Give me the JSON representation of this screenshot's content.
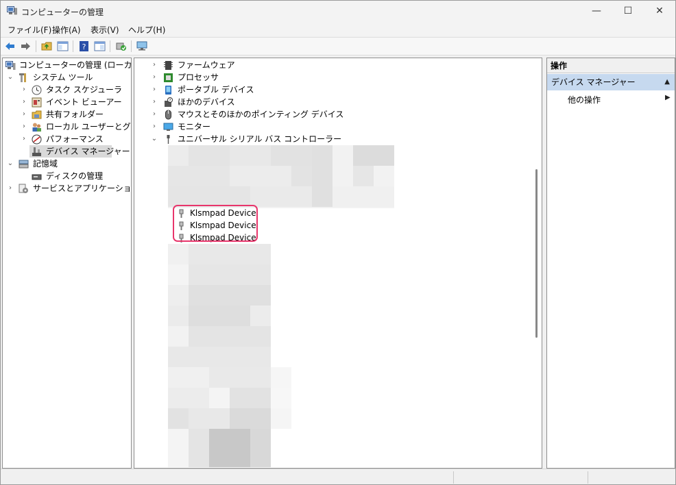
{
  "window": {
    "title": "コンピューターの管理",
    "controls": {
      "minimize": "—",
      "maximize": "☐",
      "close": "✕"
    }
  },
  "menu": [
    "ファイル(F)",
    "操作(A)",
    "表示(V)",
    "ヘルプ(H)"
  ],
  "toolbar": [
    "back-icon",
    "forward-icon",
    "up-folder-icon",
    "show-hide-tree-icon",
    "help-icon",
    "properties-icon",
    "update-driver-icon",
    "scan-hardware-icon"
  ],
  "tree": {
    "root": "コンピューターの管理 (ローカル)",
    "system_tools": "システム ツール",
    "task_scheduler": "タスク スケジューラ",
    "event_viewer": "イベント ビューアー",
    "shared_folders": "共有フォルダー",
    "local_users": "ローカル ユーザーとグループ",
    "performance": "パフォーマンス",
    "device_manager": "デバイス マネージャー",
    "storage": "記憶域",
    "disk_management": "ディスクの管理",
    "services_apps": "サービスとアプリケーション"
  },
  "devices": {
    "firmware": "ファームウェア",
    "processor": "プロセッサ",
    "portable": "ポータブル デバイス",
    "other": "ほかのデバイス",
    "mouse": "マウスとそのほかのポインティング デバイス",
    "monitor": "モニター",
    "usb": "ユニバーサル シリアル バス コントローラー",
    "usb_children": [
      "Klsmpad Device",
      "Klsmpad Device",
      "Klsmpad Device"
    ]
  },
  "actions": {
    "header": "操作",
    "section": "デバイス マネージャー",
    "more": "他の操作"
  },
  "colors": {
    "highlight": "#e8356b",
    "selection": "#d9d9d9",
    "action_section": "#c6d9ef"
  }
}
